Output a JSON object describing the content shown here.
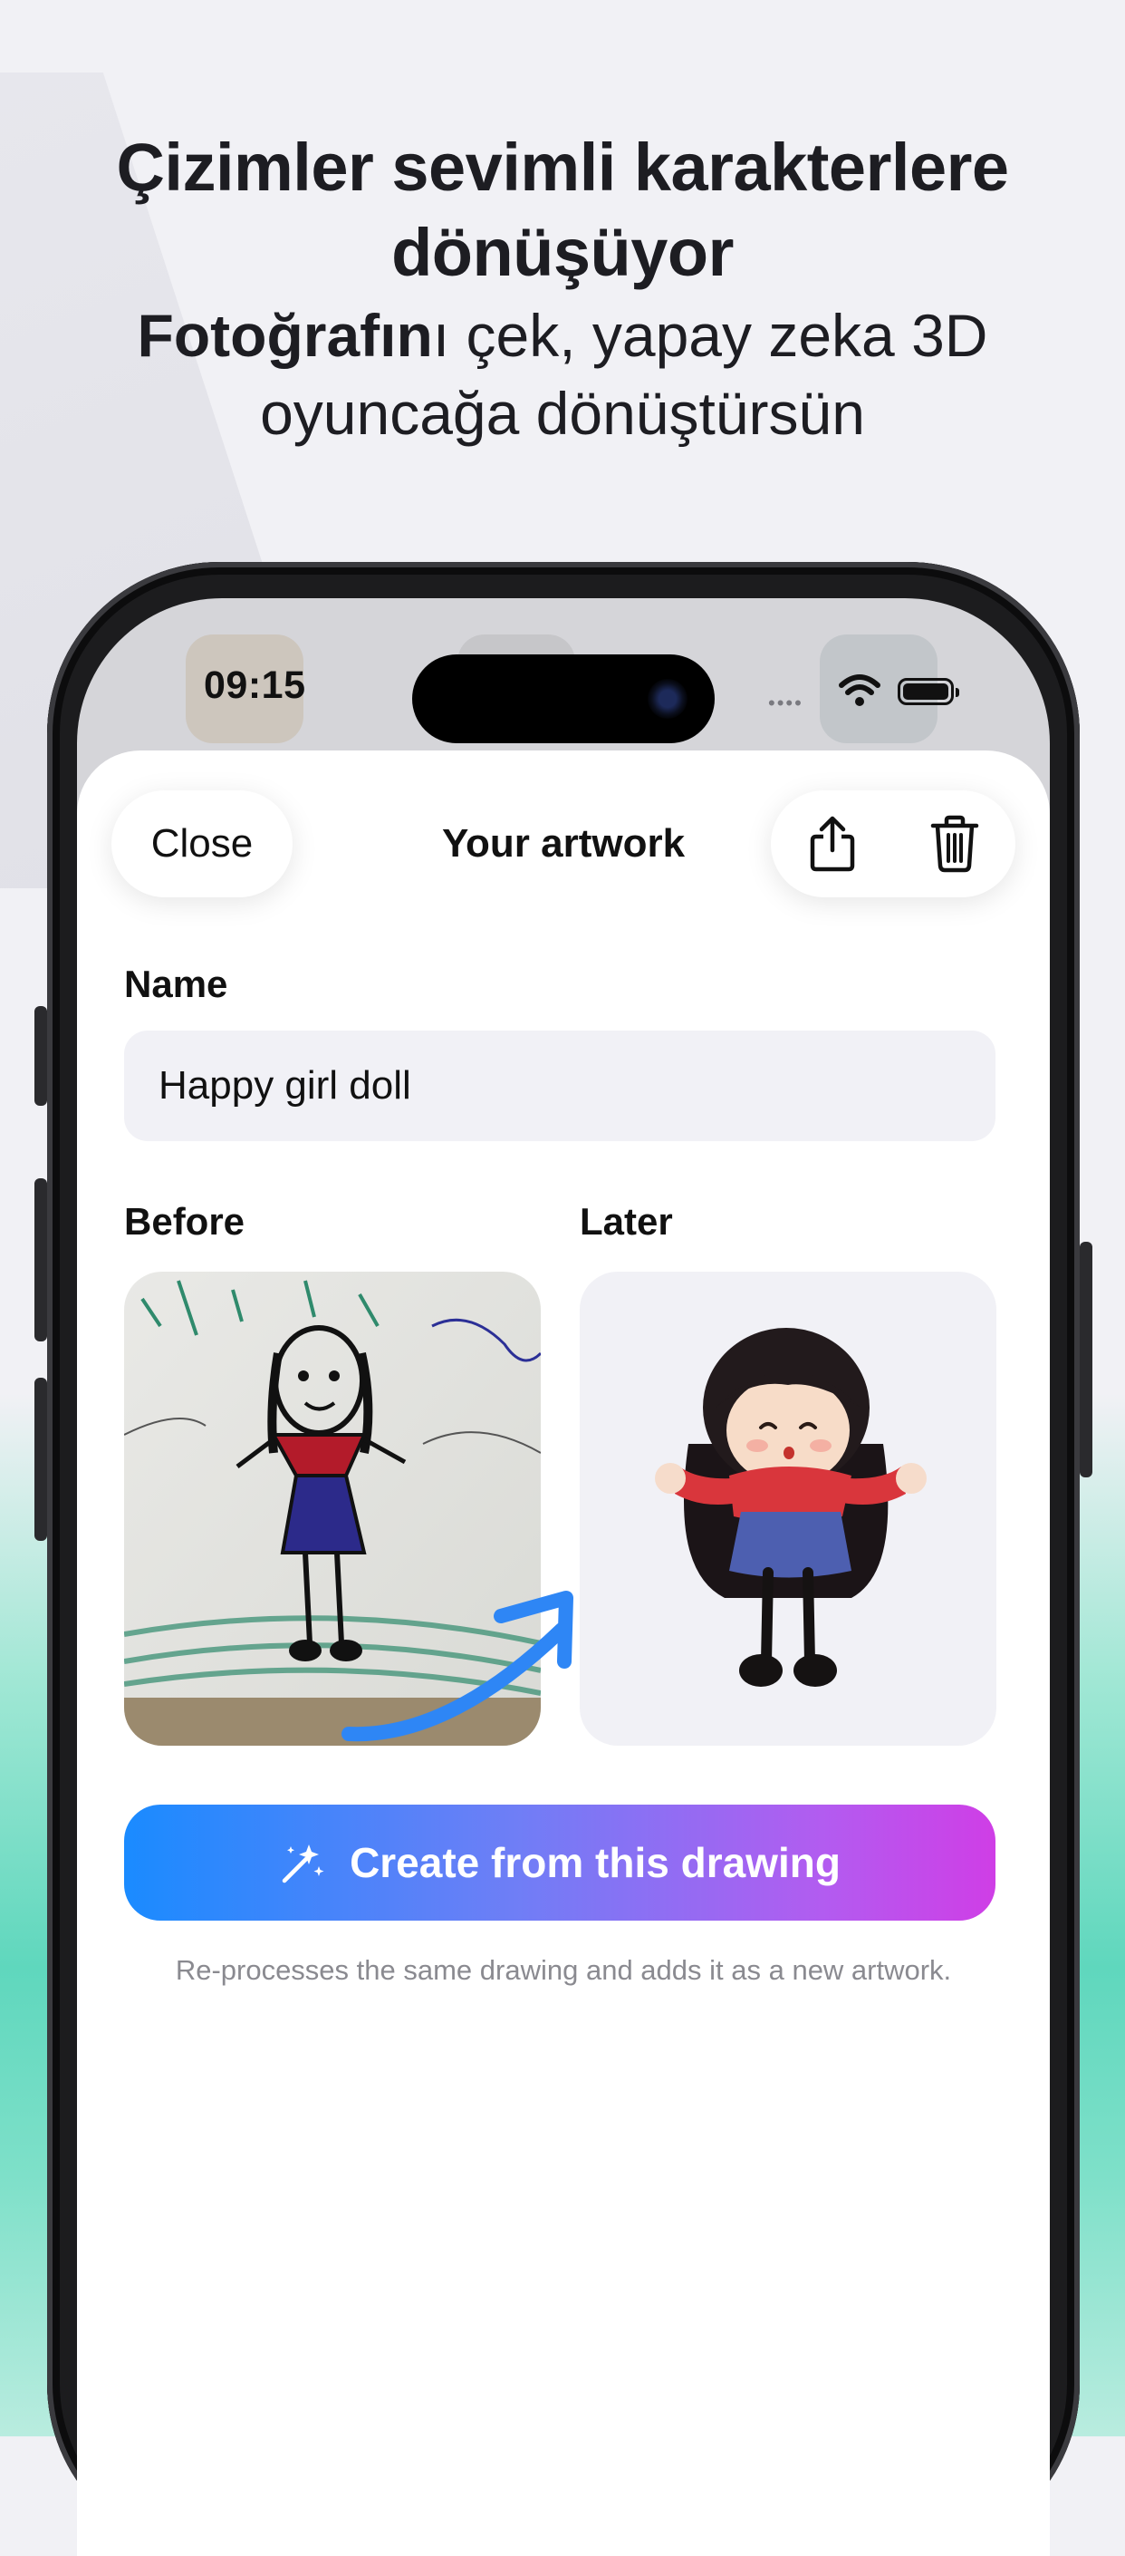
{
  "headline": {
    "title_line1": "Çizimler sevimli karakterlere",
    "title_line2": "dönüşüyor",
    "subtitle_bold": "Fotoğrafın",
    "subtitle_rest": "ı çek, yapay zeka 3D",
    "subtitle_line2": "oyuncağa dönüştürsün"
  },
  "status_bar": {
    "time": "09:15",
    "signal": "••••"
  },
  "sheet": {
    "title": "Your artwork",
    "close_label": "Close",
    "share_icon": "share-icon",
    "delete_icon": "trash-icon"
  },
  "form": {
    "name_label": "Name",
    "name_value": "Happy girl doll",
    "before_label": "Before",
    "later_label": "Later"
  },
  "cta": {
    "label": "Create from this drawing",
    "icon": "magic-sparkles-icon",
    "hint": "Re-processes the same drawing and adds it as a new artwork."
  },
  "colors": {
    "cta_gradient_start": "#1a8bff",
    "cta_gradient_end": "#cf3ee6",
    "arrow": "#2e86f5",
    "background_teal": "#5fd7bd"
  }
}
